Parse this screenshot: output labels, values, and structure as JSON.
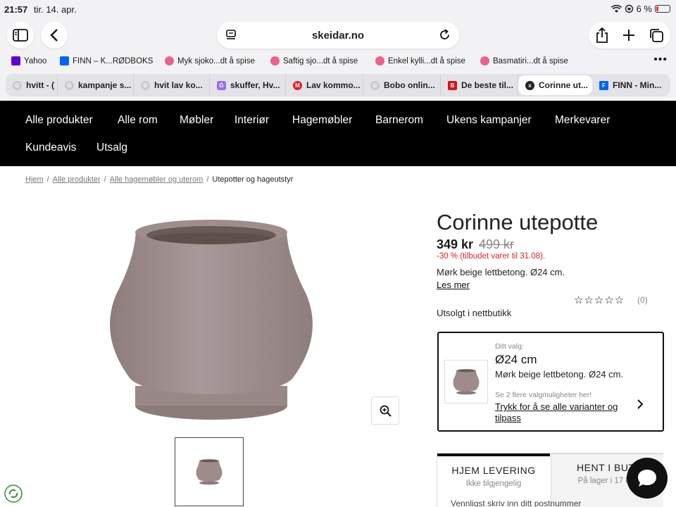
{
  "status_bar": {
    "time": "21:57",
    "date": "tir. 14. apr.",
    "battery": "6 %"
  },
  "toolbar": {
    "url": "skeidar.no"
  },
  "bookmarks": [
    {
      "label": "Yahoo",
      "color": "#6001d2"
    },
    {
      "label": "FINN – K...RØDBOKS",
      "color": "#0063fb"
    },
    {
      "label": "Myk sjoko...dt å spise",
      "color": "#e8628b"
    },
    {
      "label": "Saftig sjo...dt å spise",
      "color": "#e8628b"
    },
    {
      "label": "Enkel kylli...dt å spise",
      "color": "#e8628b"
    },
    {
      "label": "Basmatiri...dt å spise",
      "color": "#e8628b"
    }
  ],
  "tabs": [
    {
      "label": "hvitt - (",
      "icon": "G"
    },
    {
      "label": "kampanje s...",
      "icon": "G"
    },
    {
      "label": "hvit lav ko...",
      "icon": "G"
    },
    {
      "label": "skuffer, Hv...",
      "icon": "G"
    },
    {
      "label": "Lav kommo...",
      "icon": "M"
    },
    {
      "label": "Bobo onlin...",
      "icon": "G"
    },
    {
      "label": "De beste til...",
      "icon": "B"
    },
    {
      "label": "Corinne ut...",
      "icon": "x"
    },
    {
      "label": "FINN - Min...",
      "icon": "F"
    }
  ],
  "site_nav": [
    "Alle produkter",
    "Alle rom",
    "Møbler",
    "Interiør",
    "Hagemøbler",
    "Barnerom",
    "Ukens kampanjer",
    "Merkevarer",
    "Kundeavis",
    "Utsalg"
  ],
  "breadcrumb": {
    "links": [
      "Hjem",
      "Alle produkter",
      "Alle hagemøbler og uterom"
    ],
    "separator": "/",
    "current": "Utepotter og hageutstyr"
  },
  "product": {
    "title": "Corinne utepotte",
    "price": "349 kr",
    "old_price": "499 kr",
    "discount": "-30 % (tilbudet varer til 31.08).",
    "description": "Mørk beige lettbetong. Ø24 cm.",
    "read_more": "Les mer",
    "rating_count": "(0)",
    "rating_stars": 0,
    "stock_online": "Utsolgt i nettbutikk",
    "colors": {
      "pot": "#9c8c8a",
      "discount": "#d3262b"
    }
  },
  "variant": {
    "label": "Ditt valg:",
    "size": "Ø24 cm",
    "description": "Mørk beige lettbetong. Ø24 cm.",
    "more_options": "Se 2 flere valgmuligheter her!",
    "link": "Trykk for å se alle varianter og tilpass"
  },
  "delivery": {
    "home_title": "HJEM LEVERING",
    "home_sub": "Ikke tilgjengelig",
    "store_title": "HENT I BUTI",
    "store_sub": "På lager i 17 but",
    "below_text": "Vennligst skriv inn ditt postnummer"
  }
}
